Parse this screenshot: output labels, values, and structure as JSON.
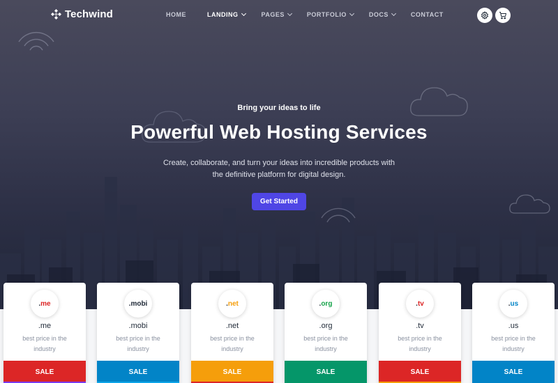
{
  "brand": {
    "name": "Techwind"
  },
  "nav": {
    "items": [
      {
        "label": "HOME",
        "dropdown": false,
        "active": false
      },
      {
        "label": "LANDING",
        "dropdown": true,
        "active": true
      },
      {
        "label": "PAGES",
        "dropdown": true,
        "active": false
      },
      {
        "label": "PORTFOLIO",
        "dropdown": true,
        "active": false
      },
      {
        "label": "DOCS",
        "dropdown": true,
        "active": false
      },
      {
        "label": "CONTACT",
        "dropdown": false,
        "active": false
      }
    ],
    "actions": [
      {
        "icon": "settings-icon"
      },
      {
        "icon": "cart-icon"
      }
    ]
  },
  "hero": {
    "eyebrow": "Bring your ideas to life",
    "title": "Powerful Web Hosting Services",
    "subtitle": "Create, collaborate, and turn your ideas into incredible products with the definitive platform for digital design.",
    "cta_label": "Get Started"
  },
  "domains": [
    {
      "badge": "me",
      "name": ".me",
      "desc": "best price in the industry",
      "sale": "SALE",
      "color": "#dc2626"
    },
    {
      "badge": "mobi",
      "name": ".mobi",
      "desc": "best price in the industry",
      "sale": "SALE",
      "color": "#0284c7"
    },
    {
      "badge": "net",
      "name": ".net",
      "desc": "best price in the industry",
      "sale": "SALE",
      "color": "#f59e0b"
    },
    {
      "badge": "org",
      "name": ".org",
      "desc": "best price in the industry",
      "sale": "SALE",
      "color": "#059669"
    },
    {
      "badge": "tv",
      "name": ".tv",
      "desc": "best price in the industry",
      "sale": "SALE",
      "color": "#dc2626"
    },
    {
      "badge": "us",
      "name": ".us",
      "desc": "best price in the industry",
      "sale": "SALE",
      "color": "#0284c7"
    }
  ],
  "badge_text_colors": [
    "#dc2626",
    "#1f2937",
    "#f59e0b",
    "#16a34a",
    "#dc2626",
    "#0284c7"
  ],
  "stripe_colors": [
    "#7c3aed",
    "#0ea5e9",
    "#dc2626",
    "#059669",
    "#f59e0b",
    "#0284c7"
  ]
}
